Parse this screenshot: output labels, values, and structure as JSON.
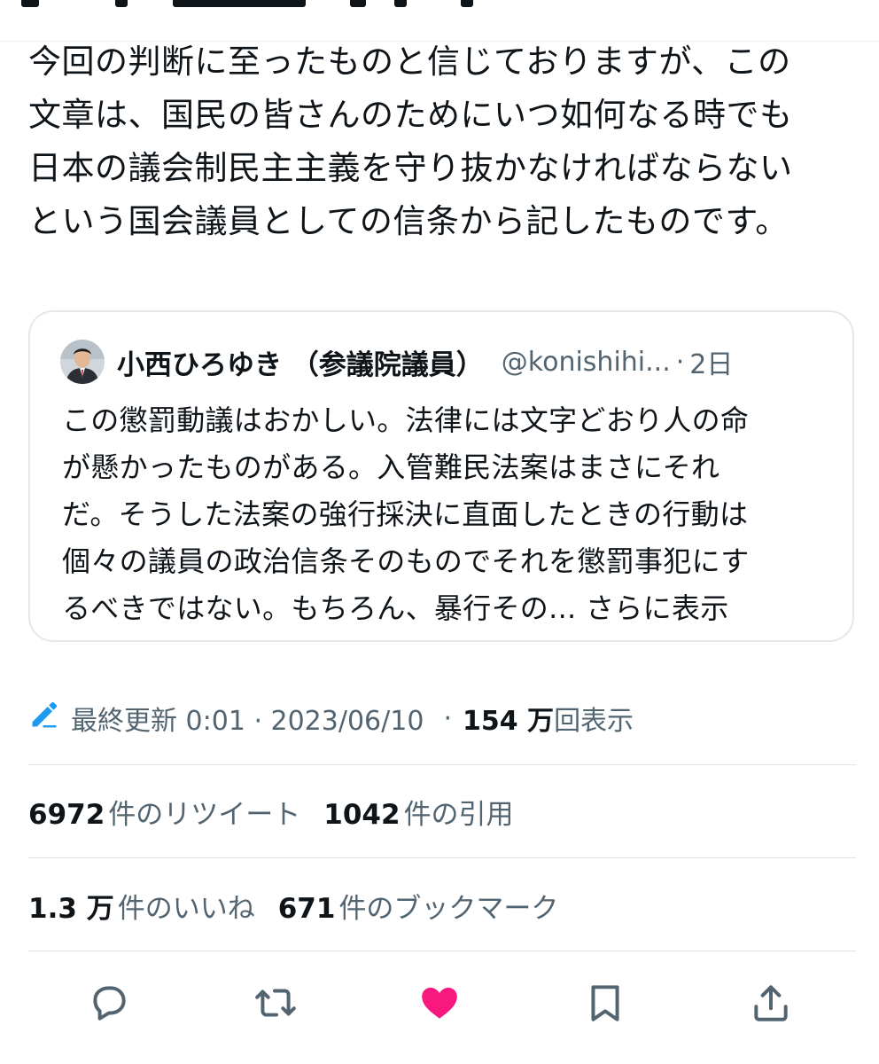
{
  "tweet": {
    "text": "今回の判断に至ったものと信じておりますが、この\n文章は、国民の皆さんのためにいつ如何なる時でも\n日本の議会制民主主義を守り抜かなければならない\nという国会議員としての信条から記したものです。"
  },
  "quote": {
    "name": "小西ひろゆき （参議院議員）",
    "handle": "@konishihi...",
    "separator": "·",
    "time": "2日",
    "text": "この懲罰動議はおかしい。法律には文字どおり人の命\nが懸かったものがある。入管難民法案はまさにそれ\nだ。そうした法案の強行採決に直面したときの行動は\n個々の議員の政治信条そのものでそれを懲罰事犯にす\nるべきではない。もちろん、暴行その...",
    "more_label": " さらに表示"
  },
  "meta": {
    "updated_label": "最終更新 0:01 · 2023/06/10",
    "separator": "·",
    "views_number": "154 万",
    "views_label": "回表示"
  },
  "stats": {
    "retweets_number": "6972",
    "retweets_label": "件のリツイート",
    "quotes_number": "1042",
    "quotes_label": "件の引用",
    "likes_number": "1.3 万",
    "likes_label": "件のいいね",
    "bookmarks_number": "671",
    "bookmarks_label": "件のブックマーク"
  },
  "actions": {
    "reply_icon": "reply-icon",
    "retweet_icon": "retweet-icon",
    "like_icon": "heart-icon",
    "bookmark_icon": "bookmark-icon",
    "share_icon": "share-icon"
  },
  "colors": {
    "like": "#f91880",
    "edit": "#1d9bf0",
    "secondary_text": "#536471"
  }
}
